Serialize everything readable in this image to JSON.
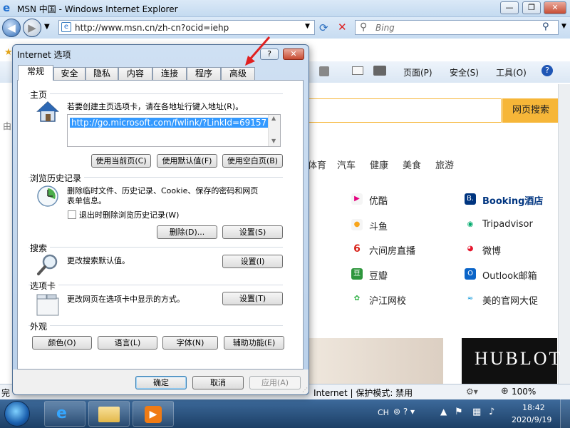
{
  "ie": {
    "title": "MSN 中国 - Windows Internet Explorer",
    "address": "http://www.msn.cn/zh-cn?ocid=iehp",
    "search_placeholder": "Bing",
    "commands": [
      "页面(P)",
      "安全(S)",
      "工具(O)"
    ]
  },
  "page": {
    "search_button": "网页搜索",
    "categories": [
      "体育",
      "汽车",
      "健康",
      "美食",
      "旅游"
    ],
    "sites_col1": [
      "优酷",
      "斗鱼",
      "六间房直播",
      "豆瓣",
      "沪江网校"
    ],
    "sites_col2": [
      "Booking酒店",
      "Tripadvisor",
      "微博",
      "Outlook邮箱",
      "美的官网大促"
    ],
    "ad_text": "HUBLOT",
    "partial_left": "由"
  },
  "status": {
    "left": "完",
    "zone": "Internet | 保护模式: 禁用",
    "zoom": "100%"
  },
  "taskbar": {
    "lang": "CH",
    "time": "18:42",
    "date": "2020/9/19"
  },
  "dialog": {
    "title": "Internet 选项",
    "help": "?",
    "close": "✕",
    "tabs": [
      "常规",
      "安全",
      "隐私",
      "内容",
      "连接",
      "程序",
      "高级"
    ],
    "home": {
      "title": "主页",
      "desc": "若要创建主页选项卡，请在各地址行键入地址(R)。",
      "url": "http://go.microsoft.com/fwlink/?LinkId=69157",
      "btn_current": "使用当前页(C)",
      "btn_default": "使用默认值(F)",
      "btn_blank": "使用空白页(B)"
    },
    "history": {
      "title": "浏览历史记录",
      "desc_line1": "删除临时文件、历史记录、Cookie、保存的密码和网页",
      "desc_line2": "表单信息。",
      "checkbox": "退出时删除浏览历史记录(W)",
      "btn_delete": "删除(D)...",
      "btn_settings": "设置(S)"
    },
    "search": {
      "title": "搜索",
      "desc": "更改搜索默认值。",
      "btn_settings": "设置(I)"
    },
    "tabs_section": {
      "title": "选项卡",
      "desc": "更改网页在选项卡中显示的方式。",
      "btn_settings": "设置(T)"
    },
    "appearance": {
      "title": "外观",
      "btn_colors": "颜色(O)",
      "btn_languages": "语言(L)",
      "btn_fonts": "字体(N)",
      "btn_accessibility": "辅助功能(E)"
    },
    "footer": {
      "ok": "确定",
      "cancel": "取消",
      "apply": "应用(A)"
    }
  }
}
